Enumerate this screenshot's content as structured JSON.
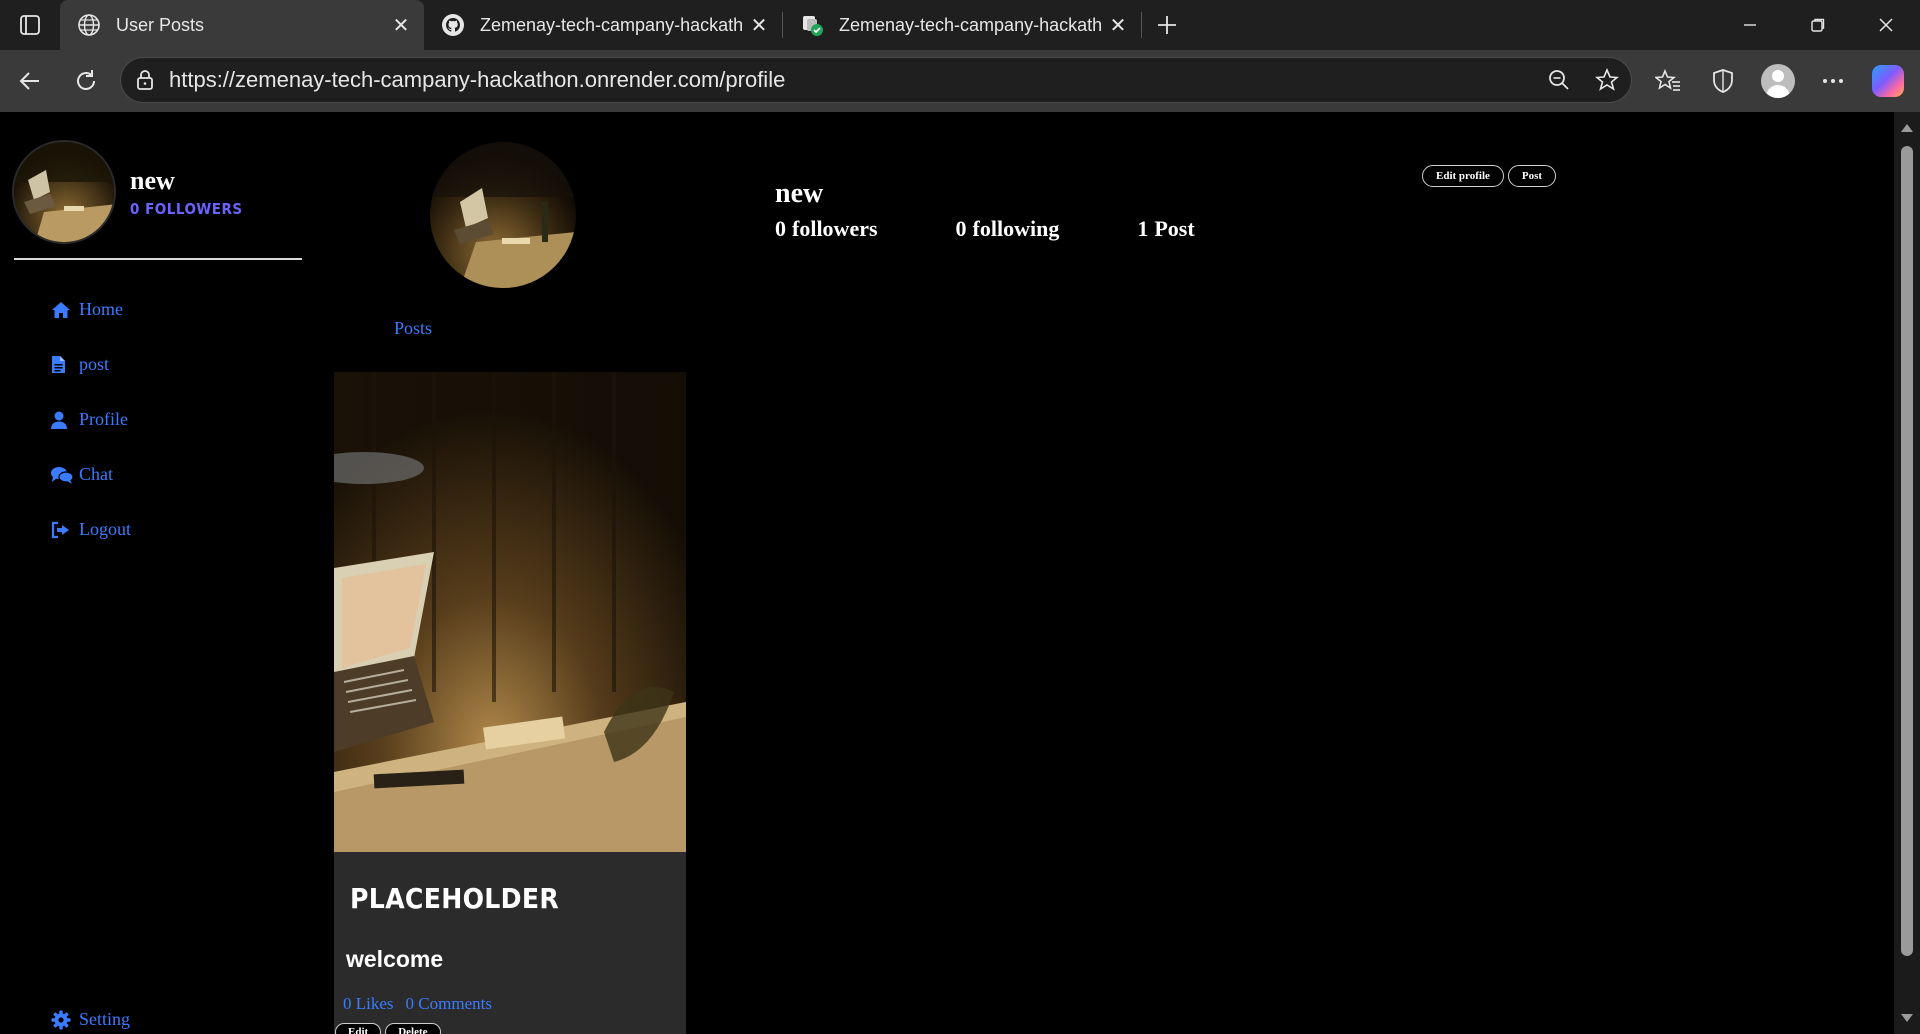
{
  "browser": {
    "tabs": [
      {
        "title": "User Posts",
        "icon": "globe-icon",
        "active": true
      },
      {
        "title": "Zemenay-tech-campany-hackath",
        "icon": "github-icon",
        "active": false
      },
      {
        "title": "Zemenay-tech-campany-hackath",
        "icon": "render-icon",
        "active": false
      }
    ],
    "url": "https://zemenay-tech-campany-hackathon.onrender.com/profile"
  },
  "sidebar": {
    "user_name": "new",
    "followers_label": "0 FOLLOWERS",
    "nav": [
      {
        "label": "Home",
        "icon": "home-icon"
      },
      {
        "label": "post",
        "icon": "file-icon"
      },
      {
        "label": "Profile",
        "icon": "user-icon"
      },
      {
        "label": "Chat",
        "icon": "chat-icon"
      },
      {
        "label": "Logout",
        "icon": "logout-icon"
      }
    ],
    "setting_label": "Setting"
  },
  "profile": {
    "name": "new",
    "followers_count": "0",
    "followers_label": "followers",
    "following_count": "0",
    "following_label": "following",
    "posts_count": "1",
    "posts_label": "Post",
    "edit_profile_label": "Edit profile",
    "post_button_label": "Post",
    "posts_tab_label": "Posts"
  },
  "post": {
    "title": "PLACEHOLDER",
    "body": "welcome",
    "likes": "0 Likes",
    "comments": "0 Comments",
    "edit_label": "Edit",
    "delete_label": "Delete"
  },
  "colors": {
    "accent_link": "#3b7bff",
    "followers_purple": "#6b63ff",
    "page_bg": "#000000",
    "card_bg": "#2b2b2b"
  }
}
